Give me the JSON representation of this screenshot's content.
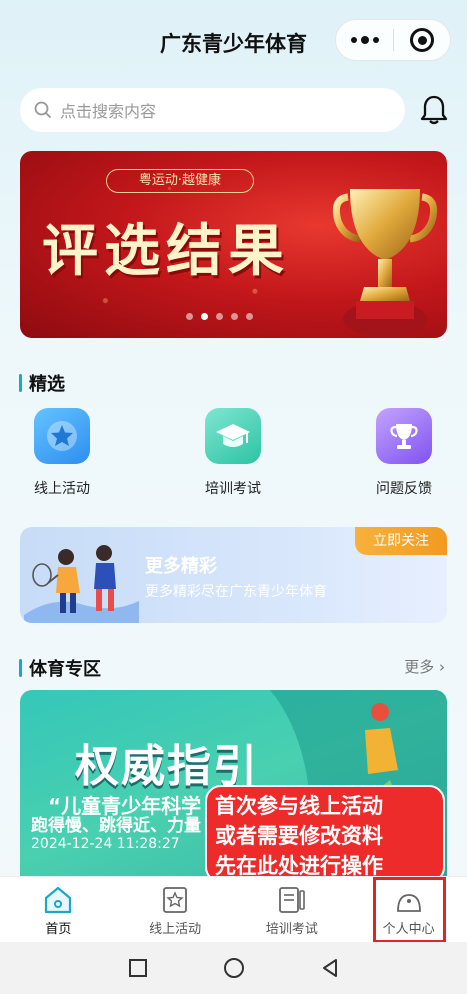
{
  "header": {
    "title": "广东青少年体育"
  },
  "search": {
    "placeholder": "点击搜索内容"
  },
  "banner": {
    "tag": "粤运动·越健康",
    "title": "评选结果",
    "dot_count": 5,
    "active_dot": 1
  },
  "featured": {
    "title": "精选",
    "items": [
      {
        "label": "线上活动",
        "icon": "star-icon",
        "color": "#2d9cf0"
      },
      {
        "label": "培训考试",
        "icon": "graduation-cap-icon",
        "color": "#2fc7a8"
      },
      {
        "label": "问题反馈",
        "icon": "trophy-icon",
        "color": "#8b5cf0"
      }
    ]
  },
  "promo": {
    "title": "更多精彩",
    "subtitle": "更多精彩尽在广东青少年体育",
    "button": "立即关注"
  },
  "sports": {
    "title": "体育专区",
    "more": "更多",
    "card": {
      "headline": "权威指引",
      "line1": "“儿童青少年科学",
      "line2": "跑得慢、跳得近、力量",
      "date": "2024-12-24 11:28:27"
    }
  },
  "tooltip": {
    "lines": [
      "首次参与线上活动",
      "或者需要修改资料",
      "先在此处进行操作"
    ]
  },
  "tabbar": {
    "items": [
      {
        "label": "首页",
        "icon": "home-icon",
        "active": true
      },
      {
        "label": "线上活动",
        "icon": "activity-icon",
        "active": false
      },
      {
        "label": "培训考试",
        "icon": "exam-icon",
        "active": false
      },
      {
        "label": "个人中心",
        "icon": "user-icon",
        "active": false
      }
    ]
  },
  "colors": {
    "accent": "#1aa7c8",
    "tooltip": "#ed2b2b",
    "highlight": "#e0242a"
  }
}
